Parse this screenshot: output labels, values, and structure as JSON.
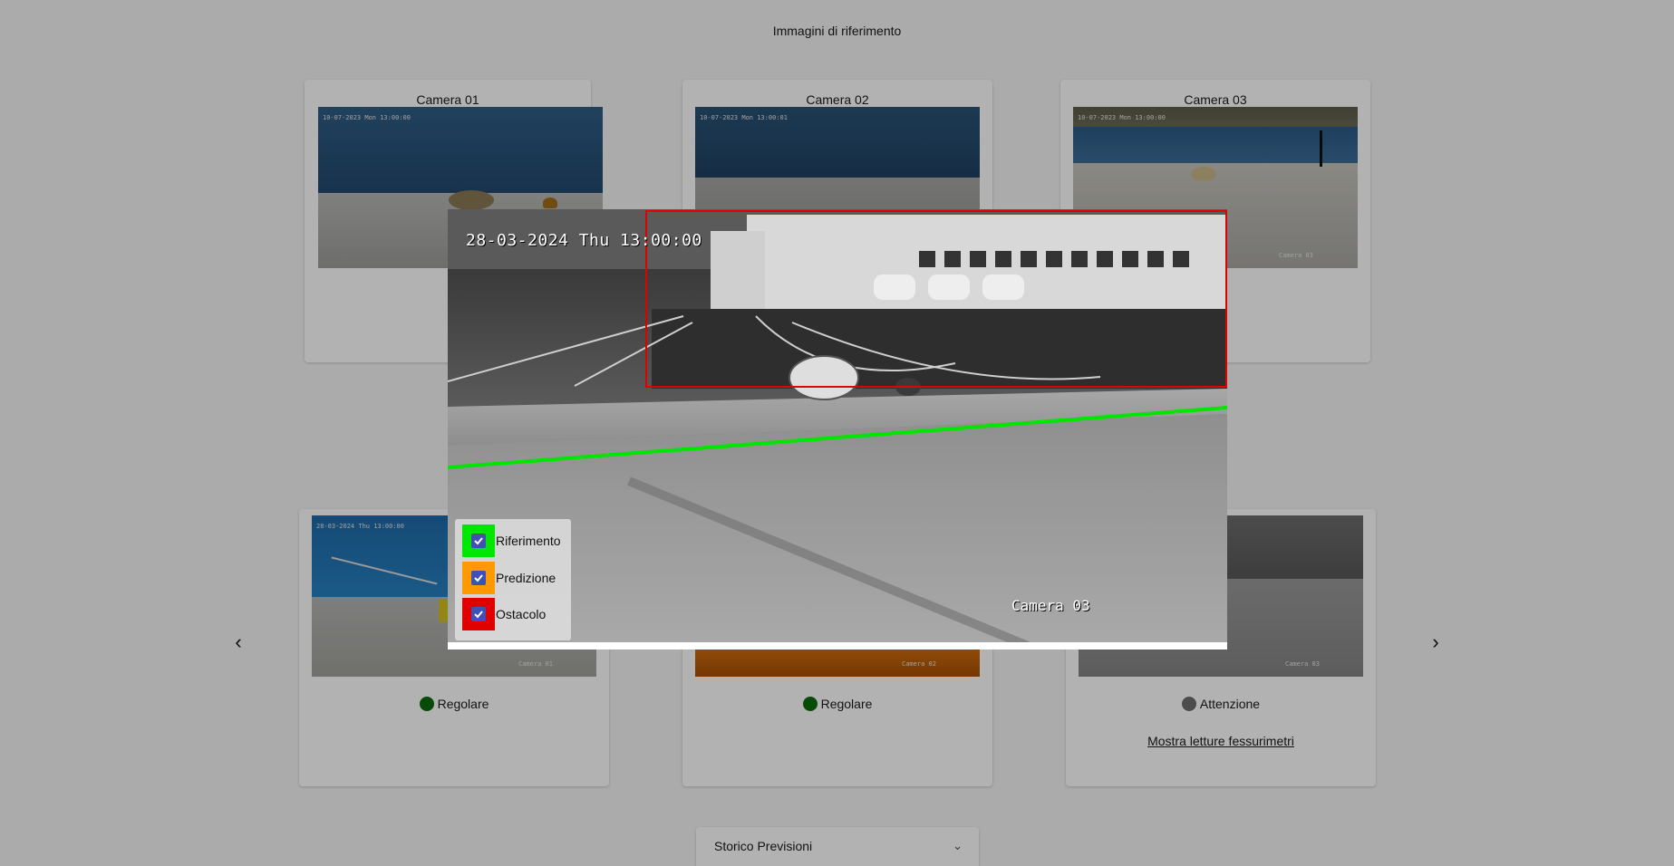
{
  "page": {
    "title": "Immagini di riferimento"
  },
  "colors": {
    "reference": "#00e600",
    "prediction": "#ff9900",
    "obstacle": "#e00000",
    "status_ok": "#0a6e0a",
    "status_warn": "#6e6e6e",
    "checkbox": "#3f51b5"
  },
  "reference_cards": [
    {
      "title": "Camera 01",
      "osd_date": "10-07-2023 Mon 13:00:00"
    },
    {
      "title": "Camera 02",
      "osd_date": "10-07-2023 Mon 13:00:01"
    },
    {
      "title": "Camera 03",
      "osd_date": "10-07-2023 Mon 13:00:00",
      "osd_cam": "Camera 03"
    }
  ],
  "live_cards": [
    {
      "osd_date": "28-03-2024 Thu 13:00:00",
      "osd_cam": "Camera 01",
      "status": "Regolare",
      "status_color": "status_ok"
    },
    {
      "osd_cam": "Camera 02",
      "status": "Regolare",
      "status_color": "status_ok"
    },
    {
      "osd_cam": "Camera 03",
      "status": "Attenzione",
      "status_color": "status_warn",
      "link": "Mostra letture fessurimetri"
    }
  ],
  "navigation": {
    "prev_icon": "chevron-left-icon",
    "next_icon": "chevron-right-icon",
    "prev_glyph": "‹",
    "next_glyph": "›"
  },
  "accordion": {
    "label": "Storico Previsioni",
    "icon": "chevron-down-icon",
    "glyph": "⌄"
  },
  "modal": {
    "osd_date": "28-03-2024 Thu 13:00:00",
    "osd_cam": "Camera 03",
    "legend": [
      {
        "label": "Riferimento",
        "color": "reference",
        "checked": true
      },
      {
        "label": "Predizione",
        "color": "prediction",
        "checked": true
      },
      {
        "label": "Ostacolo",
        "color": "obstacle",
        "checked": true
      }
    ]
  }
}
